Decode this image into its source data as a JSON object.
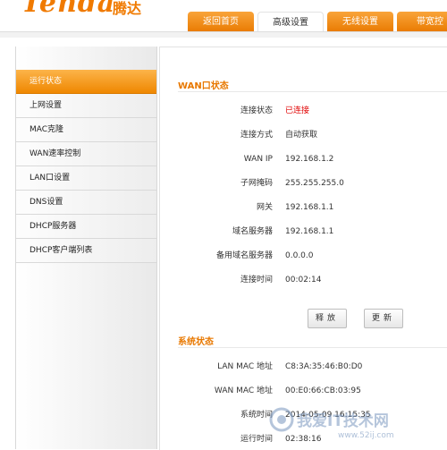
{
  "header": {
    "logo_text": "Tenda",
    "logo_cn": "腾达",
    "tabs": [
      {
        "label": "返回首页"
      },
      {
        "label": "高级设置"
      },
      {
        "label": "无线设置"
      },
      {
        "label": "带宽控"
      }
    ],
    "active_tab": "高级设置"
  },
  "sidebar": {
    "items": [
      {
        "label": "运行状态",
        "active": true
      },
      {
        "label": "上网设置"
      },
      {
        "label": "MAC克隆"
      },
      {
        "label": "WAN速率控制"
      },
      {
        "label": "LAN口设置"
      },
      {
        "label": "DNS设置"
      },
      {
        "label": "DHCP服务器"
      },
      {
        "label": "DHCP客户端列表"
      }
    ]
  },
  "wan": {
    "title": "WAN口状态",
    "rows": [
      {
        "label": "连接状态",
        "value": "已连接"
      },
      {
        "label": "连接方式",
        "value": "自动获取"
      },
      {
        "label": "WAN IP",
        "value": "192.168.1.2"
      },
      {
        "label": "子网掩码",
        "value": "255.255.255.0"
      },
      {
        "label": "网关",
        "value": "192.168.1.1"
      },
      {
        "label": "域名服务器",
        "value": "192.168.1.1"
      },
      {
        "label": "备用域名服务器",
        "value": "0.0.0.0"
      },
      {
        "label": "连接时间",
        "value": "00:02:14"
      }
    ],
    "release_label": "释放",
    "renew_label": "更新"
  },
  "system": {
    "title": "系统状态",
    "rows": [
      {
        "label": "LAN MAC 地址",
        "value": "C8:3A:35:46:B0:D0"
      },
      {
        "label": "WAN MAC 地址",
        "value": "00:E0:66:CB:03:95"
      },
      {
        "label": "系统时间",
        "value": "2014-05-09 16:15:35"
      },
      {
        "label": "运行时间",
        "value": "02:38:16"
      }
    ]
  },
  "watermark": {
    "text": "我爱IT技术网",
    "url": "www.52ij.com"
  },
  "colors": {
    "accent": "#f08400",
    "connected": "#e00000"
  }
}
